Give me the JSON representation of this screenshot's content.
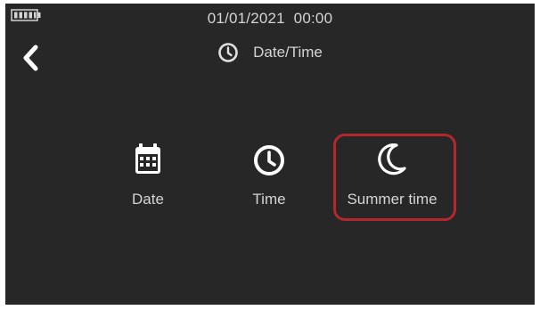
{
  "status_bar": {
    "datetime": "01/01/2021  00:00",
    "battery_icon": "battery-full-icon"
  },
  "header": {
    "back_icon": "chevron-left-icon",
    "title_icon": "clock-icon",
    "title": "Date/Time"
  },
  "menu": {
    "items": [
      {
        "label": "Date",
        "icon": "calendar-icon"
      },
      {
        "label": "Time",
        "icon": "clock-icon"
      },
      {
        "label": "Summer time",
        "icon": "moon-icon",
        "selected": true
      }
    ]
  },
  "colors": {
    "background": "#272727",
    "text": "#d4d4d4",
    "highlight": "#b3282d"
  }
}
